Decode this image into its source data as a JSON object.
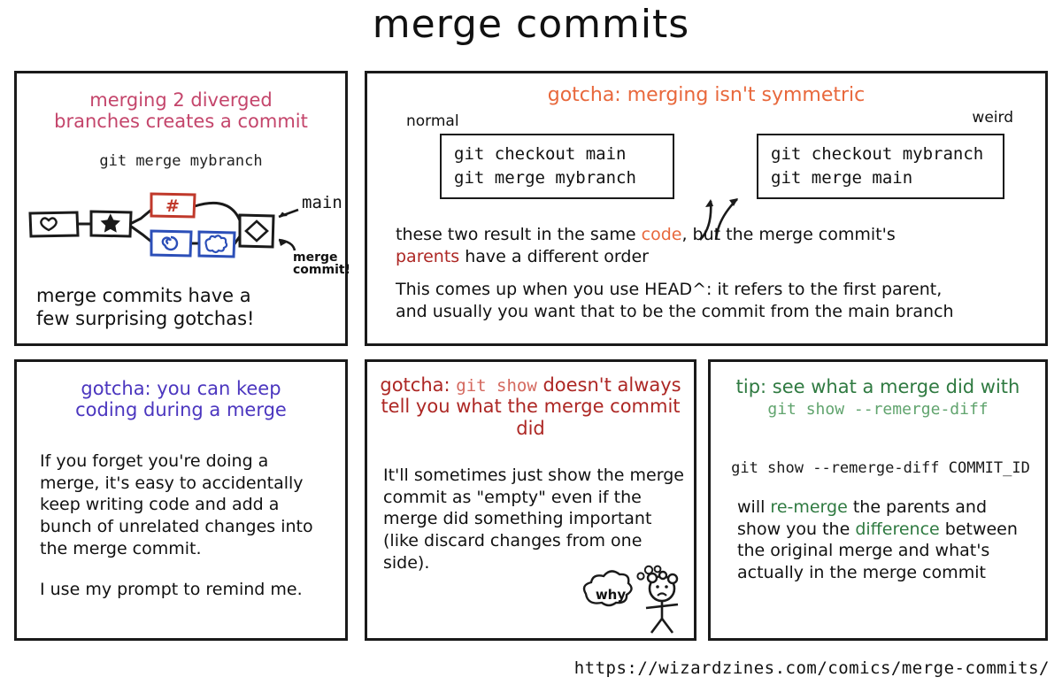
{
  "title": "merge commits",
  "footer_url": "https://wizardzines.com/comics/merge-commits/",
  "panels": {
    "intro": {
      "title_line1": "merging 2 diverged",
      "title_line2": "branches creates a commit",
      "command": "git merge mybranch",
      "graph": {
        "main_label": "main",
        "merge_label_line1": "merge",
        "merge_label_line2": "commit!",
        "node_glyphs": [
          "heart",
          "star",
          "hash",
          "spiral",
          "squiggle",
          "diamond"
        ]
      },
      "footer_line1": "merge commits have a",
      "footer_line2": "few surprising gotchas!"
    },
    "symmetric": {
      "title": "gotcha: merging isn't symmetric",
      "label_left": "normal",
      "label_right": "weird",
      "codebox_left": [
        "git checkout main",
        "git merge mybranch"
      ],
      "codebox_right": [
        "git checkout mybranch",
        "git merge main"
      ],
      "para1_a": "these two result in the same ",
      "para1_highlight_code": "code",
      "para1_b": ", but the merge commit's",
      "para1_highlight_parents": "parents",
      "para1_c": " have a different order",
      "para2_line1": "This comes up when you use HEAD^: it refers to the first parent,",
      "para2_line2": "and usually you want that to be the commit from the main branch",
      "para2_inline_code": "HEAD^"
    },
    "keepcoding": {
      "title_line1": "gotcha: you can keep",
      "title_line2": "coding during a merge",
      "paragraph1": "If you forget you're doing a merge, it's easy to accidentally keep writing code and add a bunch of unrelated changes into the merge commit.",
      "paragraph2": "I use my prompt to remind me."
    },
    "gitshow": {
      "title_a": "gotcha: ",
      "title_code": "git show",
      "title_b": " doesn't always tell you what the merge commit did",
      "body": "It'll sometimes just show the merge commit as \"empty\" even if the merge did something important (like discard changes from one side).",
      "stickfigure_bubble": "why"
    },
    "tip": {
      "title_a": "tip: see what a merge did with",
      "title_code": "git show --remerge-diff",
      "command": "git show --remerge-diff COMMIT_ID",
      "body_a": "will ",
      "body_highlight1": "re-merge",
      "body_b": " the parents and show you the ",
      "body_highlight2": "difference",
      "body_c": " between the original merge and what's actually in the merge commit"
    }
  },
  "colors": {
    "pink": "#c4456b",
    "orange": "#e8683c",
    "purple": "#4b36bf",
    "darkred": "#ad2724",
    "green": "#2f7a41",
    "commit_red": "#c0392b",
    "commit_blue": "#2c4fb8",
    "ink": "#1a1a1a"
  }
}
